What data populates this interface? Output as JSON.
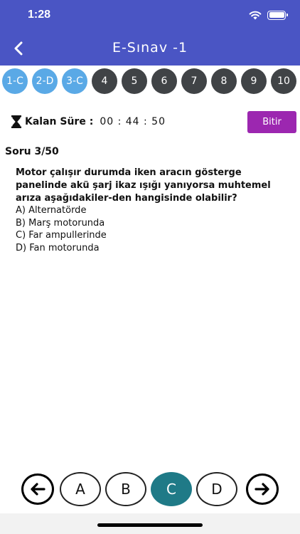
{
  "status_bar": {
    "time": "1:28"
  },
  "header": {
    "title": "E-Sınav -1"
  },
  "question_nav": {
    "items": [
      {
        "label": "1-C",
        "answered": true
      },
      {
        "label": "2-D",
        "answered": true
      },
      {
        "label": "3-C",
        "answered": true
      },
      {
        "label": "4",
        "answered": false
      },
      {
        "label": "5",
        "answered": false
      },
      {
        "label": "6",
        "answered": false
      },
      {
        "label": "7",
        "answered": false
      },
      {
        "label": "8",
        "answered": false
      },
      {
        "label": "9",
        "answered": false
      },
      {
        "label": "10",
        "answered": false
      }
    ]
  },
  "timer": {
    "label": "Kalan Süre :",
    "value": "00 : 44 : 50"
  },
  "finish_label": "Bitir",
  "question": {
    "number": "Soru 3/50",
    "text": "Motor çalışır durumda iken aracın gösterge panelinde akü şarj ikaz ışığı yanıyorsa muhtemel arıza aşağıdakiler-den hangisinde olabilir?",
    "options": [
      "A) Alternatörde",
      "B) Marş motorunda",
      "C) Far ampullerinde",
      "D) Fan motorunda"
    ]
  },
  "answers": {
    "a": "A",
    "b": "B",
    "c": "C",
    "d": "D",
    "selected": "C"
  },
  "colors": {
    "header": "#4a55c4",
    "answered": "#5aa9e6",
    "unanswered": "#404346",
    "finish": "#9c27b0",
    "selected": "#1f7a87"
  }
}
